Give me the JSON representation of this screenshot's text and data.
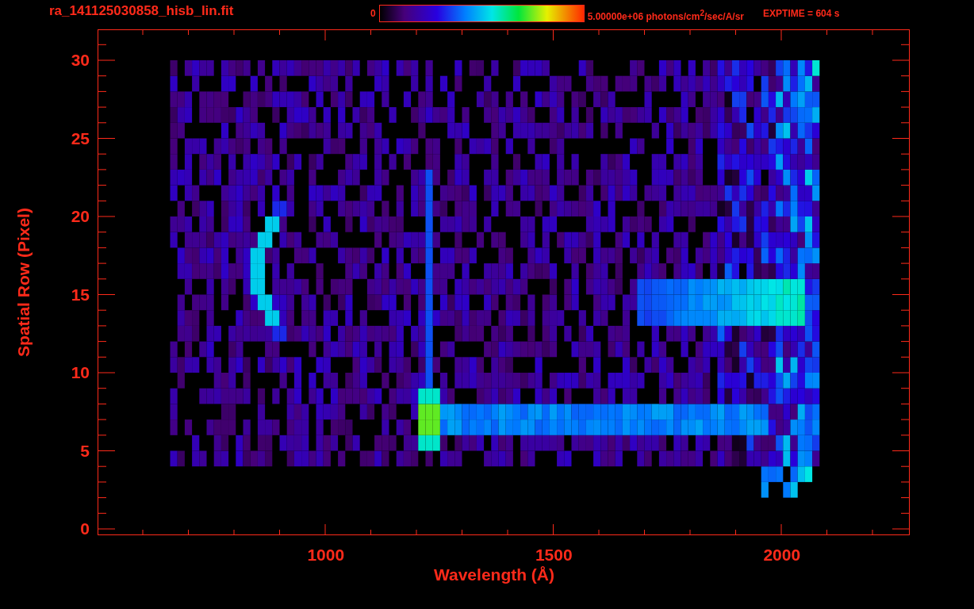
{
  "title": "ra_141125030858_hisb_lin.fit",
  "colorbar": {
    "min_label": "0",
    "max_label": "5.00000e+06 photons/cm$^{2}$/sec/A/sr"
  },
  "exposure": "EXPTIME = 604 s",
  "plot": {
    "ylabel": "Spatial Row (Pixel)",
    "xlabel": "Wavelength (Å)",
    "yticks": [
      "30",
      "25",
      "20",
      "15",
      "10",
      "5",
      "0"
    ],
    "xticks": [
      "1000",
      "1500",
      "2000"
    ]
  }
}
